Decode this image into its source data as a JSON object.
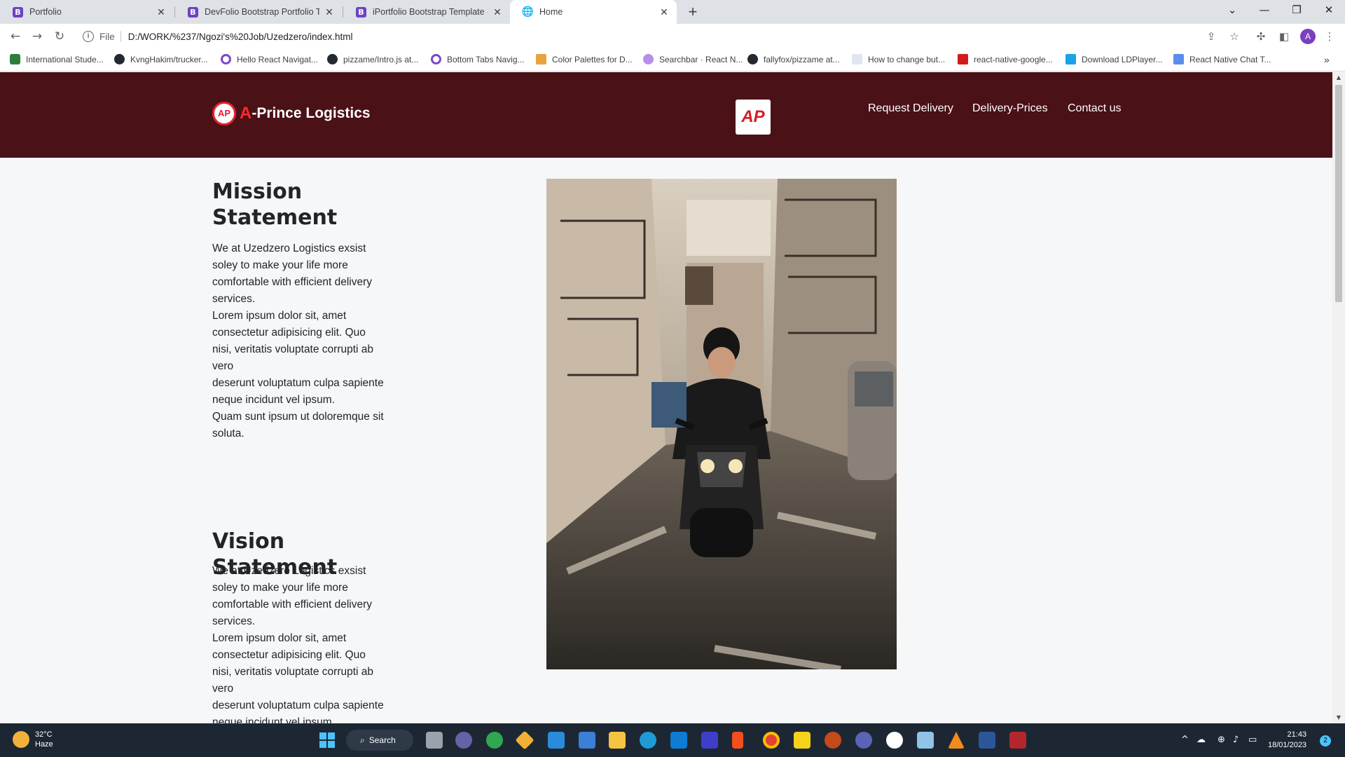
{
  "browser": {
    "tabs": [
      {
        "title": "Portfolio",
        "favicon": "B"
      },
      {
        "title": "DevFolio Bootstrap Portfolio Tem",
        "favicon": "B"
      },
      {
        "title": "iPortfolio Bootstrap Template - Ir",
        "favicon": "B"
      },
      {
        "title": "Home",
        "favicon": "globe"
      }
    ],
    "active_tab": 3,
    "new_tab_glyph": "+",
    "url_scheme": "File",
    "url": "D:/WORK/%237/Ngozi's%20Job/Uzedzero/index.html",
    "profile_initial": "A",
    "bookmarks": [
      "International Stude...",
      "KvngHakim/trucker...",
      "Hello React Navigat...",
      "pizzame/Intro.js at...",
      "Bottom Tabs Navig...",
      "Color Palettes for D...",
      "Searchbar · React N...",
      "fallyfox/pizzame at...",
      "How to change but...",
      "react-native-google...",
      "Download LDPlayer...",
      "React Native Chat T..."
    ],
    "bookmarks_more": "»"
  },
  "site": {
    "brand_logo_text": "AP",
    "brand_a": "A",
    "brand_rest": "-Prince Logistics",
    "center_logo_text": "AP",
    "nav": [
      "Request Delivery",
      "Delivery-Prices",
      "Contact us"
    ],
    "header_bg": "#4a1116",
    "mission": {
      "title": "Mission Statement",
      "paragraphs": [
        "We at Uzedzero Logistics exsist soley to make your life more comfortable with efficient delivery services.",
        "Lorem ipsum dolor sit, amet consectetur adipisicing elit. Quo nisi, veritatis voluptate corrupti ab vero",
        "deserunt voluptatum culpa sapiente neque incidunt vel ipsum.",
        "Quam sunt ipsum ut doloremque sit soluta."
      ]
    },
    "vision": {
      "title": "Vision Statement",
      "paragraphs": [
        "We at Uzedzero Logistics exsist soley to make your life more comfortable with efficient delivery services.",
        "Lorem ipsum dolor sit, amet consectetur adipisicing elit. Quo nisi, veritatis voluptate corrupti ab vero",
        "deserunt voluptatum culpa sapiente neque incidunt vel ipsum."
      ]
    }
  },
  "taskbar": {
    "temperature": "32°C",
    "condition": "Haze",
    "search_label": "Search",
    "time": "21:43",
    "date": "18/01/2023",
    "notifications": "2"
  }
}
